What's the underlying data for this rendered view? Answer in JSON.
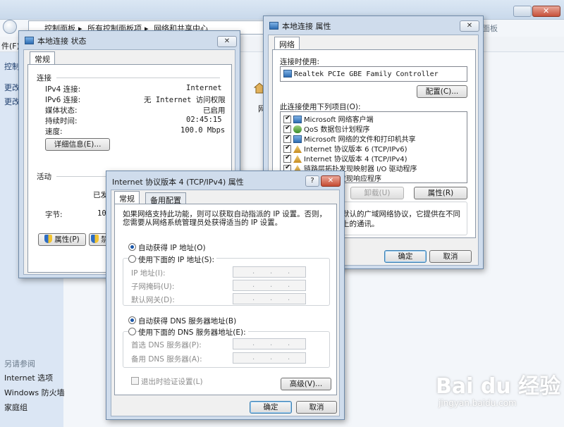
{
  "background": {
    "breadcrumb": [
      "控制面板",
      "所有控制面板项",
      "网络和共享中心"
    ],
    "search_hint": "面板",
    "menu_file": "件(F)",
    "sidebar": {
      "links": [
        "控制",
        "更改",
        "更改"
      ],
      "see_also_title": "另请参阅",
      "see_also": [
        "Internet 选项",
        "Windows 防火墙",
        "家庭组"
      ]
    },
    "network_label": "网"
  },
  "status_dialog": {
    "title": "本地连接 状态",
    "tab": "常规",
    "section_connection": "连接",
    "rows": [
      {
        "label": "IPv4 连接:",
        "value": "Internet"
      },
      {
        "label": "IPv6 连接:",
        "value": "无 Internet 访问权限"
      },
      {
        "label": "媒体状态:",
        "value": "已启用"
      },
      {
        "label": "持续时间:",
        "value": "02:45:15"
      },
      {
        "label": "速度:",
        "value": "100.0 Mbps"
      }
    ],
    "details_button": "详细信息(E)...",
    "section_activity": "活动",
    "sent_label": "已发",
    "bytes_label": "字节:",
    "bytes_value": "10,",
    "properties_button": "属性(P)",
    "disable_button_partial": "禁"
  },
  "props_dialog": {
    "title": "本地连接 属性",
    "tab": "网络",
    "connect_using_label": "连接时使用:",
    "adapter": "Realtek PCIe GBE Family Controller",
    "configure_button": "配置(C)...",
    "items_label": "此连接使用下列项目(O):",
    "items": [
      {
        "label": "Microsoft 网络客户端",
        "icon": "network-client-icon",
        "checked": "true"
      },
      {
        "label": "QoS 数据包计划程序",
        "icon": "qos-icon",
        "checked": "true"
      },
      {
        "label": "Microsoft 网络的文件和打印机共享",
        "icon": "file-share-icon",
        "checked": "true"
      },
      {
        "label": "Internet 协议版本 6 (TCP/IPv6)",
        "icon": "protocol-icon",
        "checked": "true"
      },
      {
        "label": "Internet 协议版本 4 (TCP/IPv4)",
        "icon": "protocol-icon",
        "checked": "true"
      },
      {
        "label": "链路层拓扑发现映射器 I/O 驱动程序",
        "icon": "protocol-icon",
        "checked": "true"
      },
      {
        "label": "链路层拓扑发现响应程序",
        "icon": "protocol-icon",
        "checked": "true"
      }
    ],
    "uninstall_button": "卸载(U)",
    "properties_button": "属性(R)",
    "description_line1": "默认的广域网络协议，它提供在不同",
    "description_line2": "上的通讯。",
    "ok_button": "确定",
    "cancel_button": "取消"
  },
  "ipv4_dialog": {
    "title": "Internet 协议版本 4 (TCP/IPv4) 属性",
    "help_glyph": "?",
    "tabs": [
      "常规",
      "备用配置"
    ],
    "intro_line1": "如果网络支持此功能，则可以获取自动指派的 IP 设置。否则，",
    "intro_line2": "您需要从网络系统管理员处获得适当的 IP 设置。",
    "auto_ip": "自动获得 IP 地址(O)",
    "manual_ip": "使用下面的 IP 地址(S):",
    "ip_address_label": "IP 地址(I):",
    "subnet_label": "子网掩码(U):",
    "gateway_label": "默认网关(D):",
    "auto_dns": "自动获得 DNS 服务器地址(B)",
    "manual_dns": "使用下面的 DNS 服务器地址(E):",
    "preferred_dns_label": "首选 DNS 服务器(P):",
    "alternate_dns_label": "备用 DNS 服务器(A):",
    "ip_dot": ".",
    "validate_label": "退出时验证设置(L)",
    "advanced_button": "高级(V)...",
    "ok_button": "确定",
    "cancel_button": "取消"
  },
  "watermark": {
    "brand": "Bai du 经验",
    "url": "jingyan.baidu.com"
  }
}
